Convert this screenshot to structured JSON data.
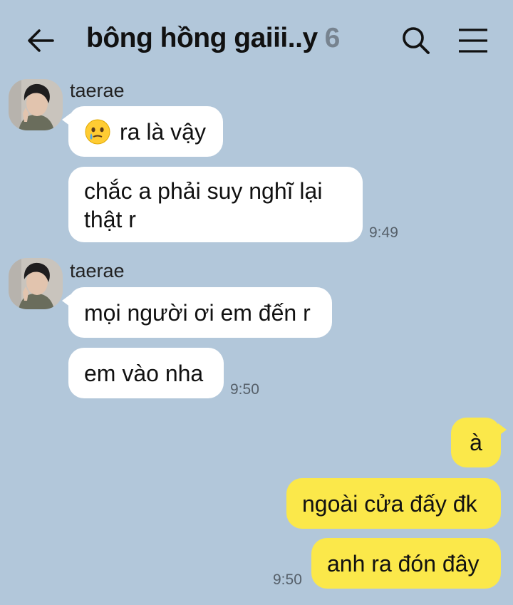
{
  "header": {
    "title": "bông hồng gaiii..y",
    "member_count": "6",
    "back_icon": "arrow-left-icon",
    "search_icon": "search-icon",
    "menu_icon": "hamburger-menu-icon"
  },
  "colors": {
    "background": "#b2c7da",
    "incoming_bubble": "#ffffff",
    "outgoing_bubble": "#fbe84a",
    "timestamp": "#56606a"
  },
  "messages": {
    "group1": {
      "sender": "taerae",
      "msg1": "ra là vậy",
      "msg1_emoji": "face-holding-back-tears",
      "msg2_line1": "chắc a phải suy nghĩ lại",
      "msg2_line2": "thật r",
      "time": "9:49"
    },
    "group2": {
      "sender": "taerae",
      "msg1": "mọi người ơi em đến r",
      "msg2": "em vào nha",
      "time": "9:50"
    },
    "outgoing": {
      "msg1": "à",
      "msg2": "ngoài cửa đấy đk",
      "msg3": "anh ra đón đây",
      "time": "9:50"
    }
  }
}
